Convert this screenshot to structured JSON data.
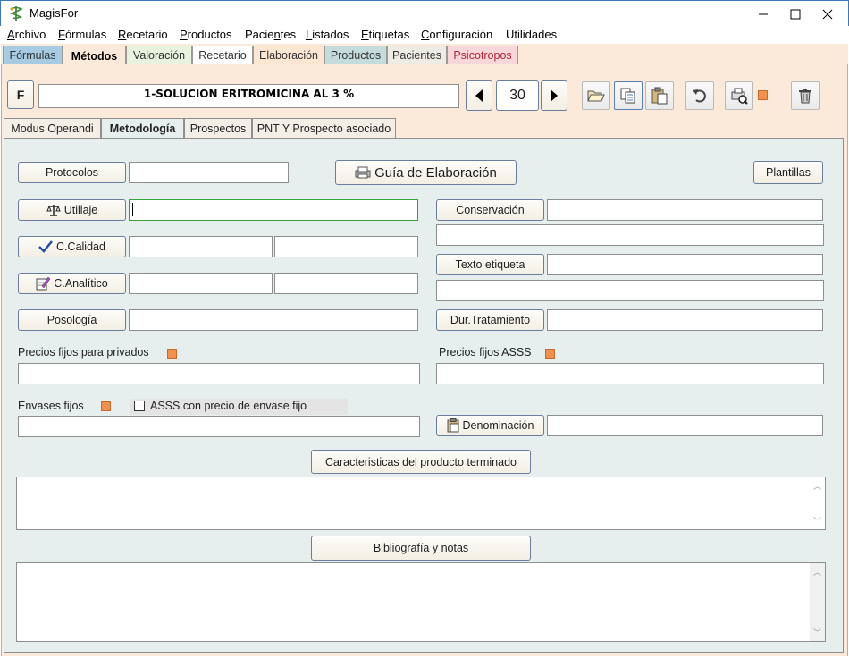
{
  "window": {
    "title": "MagisFor"
  },
  "menu": [
    "Archivo",
    "Fórmulas",
    "Recetario",
    "Productos",
    "Pacientes",
    "Listados",
    "Etiquetas",
    "Configuración",
    "Utilidades"
  ],
  "menu_underline": [
    "A",
    "F",
    "R",
    "P",
    "n",
    "L",
    "E",
    "C",
    ""
  ],
  "main_tabs": [
    "Fórmulas",
    "Métodos",
    "Valoración",
    "Recetario",
    "Elaboración",
    "Productos",
    "Pacientes",
    "Psicotropos"
  ],
  "toolbar": {
    "f_button": "F",
    "record_title": "1-SOLUCION ERITROMICINA AL 3 %",
    "counter": "30"
  },
  "sub_tabs": [
    "Modus Operandi",
    "Metodología",
    "Prospectos",
    "PNT Y Prospecto asociado"
  ],
  "form": {
    "protocolos": "Protocolos",
    "guia": "Guía de Elaboración",
    "plantillas": "Plantillas",
    "utillaje": "Utillaje",
    "calidad": "C.Calidad",
    "analitico": "C.Analítico",
    "posologia": "Posología",
    "conservacion": "Conservación",
    "texto_etiqueta": "Texto etiqueta",
    "dur_tratamiento": "Dur.Tratamiento",
    "precios_privados": "Precios fijos para privados",
    "precios_asss": "Precios fijos ASSS",
    "envases_fijos": "Envases fijos",
    "asss_precio_envase": "ASSS con precio de envase fijo",
    "denominacion": "Denominación",
    "caracteristicas": "Caracteristicas del producto terminado",
    "bibliografia": "Bibliografía y notas"
  },
  "colors": {
    "tab_formulas": "#a6cbe3",
    "tab_metodos": "#fbead9",
    "tab_valoracion": "#e7f2df",
    "tab_recetario": "#ffffff",
    "tab_elaboracion": "#fde7d3",
    "tab_productos": "#c4dcdc",
    "tab_pacientes": "#eeeae4",
    "tab_psicotropos": "#f8d7db",
    "orange_marker": "#f0914f"
  }
}
